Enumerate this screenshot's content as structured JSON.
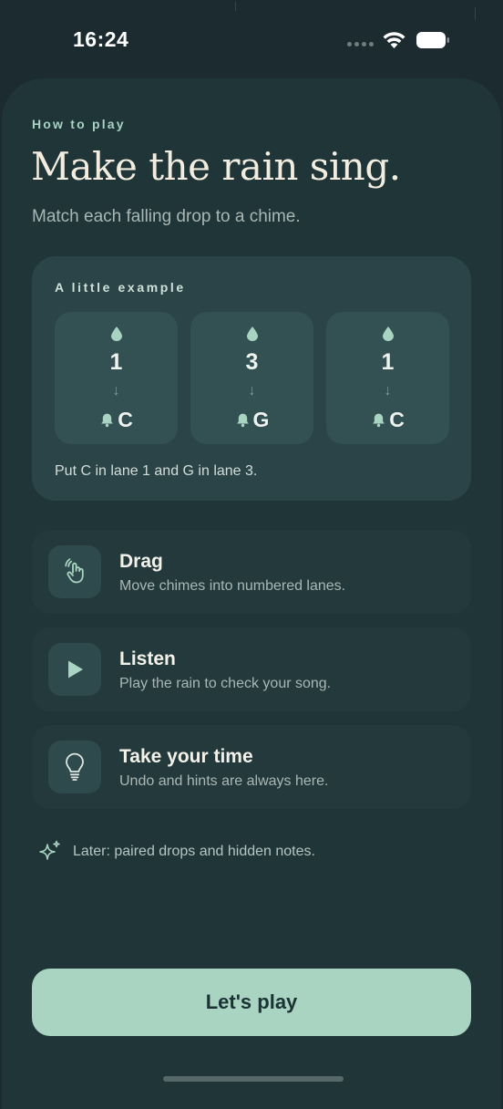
{
  "status_bar": {
    "time": "16:24",
    "icons": [
      "signal-dots-icon",
      "wifi-icon",
      "battery-icon"
    ]
  },
  "onboarding": {
    "eyebrow": "How to play",
    "title": "Make the rain sing.",
    "subtitle": "Match each falling drop to a chime."
  },
  "example": {
    "label": "A little example",
    "lanes": [
      {
        "number": "1",
        "arrow": "↓",
        "note": "C"
      },
      {
        "number": "3",
        "arrow": "↓",
        "note": "G"
      },
      {
        "number": "1",
        "arrow": "↓",
        "note": "C"
      }
    ],
    "caption": "Put C in lane 1 and G in lane 3."
  },
  "tips": [
    {
      "icon": "hand-drag-icon",
      "title": "Drag",
      "description": "Move chimes into numbered lanes."
    },
    {
      "icon": "play-icon",
      "title": "Listen",
      "description": "Play the rain to check your song."
    },
    {
      "icon": "lightbulb-icon",
      "title": "Take your time",
      "description": "Undo and hints are always here."
    }
  ],
  "later_note": "Later: paired drops and hidden notes.",
  "cta": {
    "label": "Let's play"
  },
  "colors": {
    "background": "#1b2b2f",
    "sheet": "#1f3538",
    "card": "#2a4447",
    "accent": "#a9d4c1",
    "headline": "#f3eddf"
  }
}
